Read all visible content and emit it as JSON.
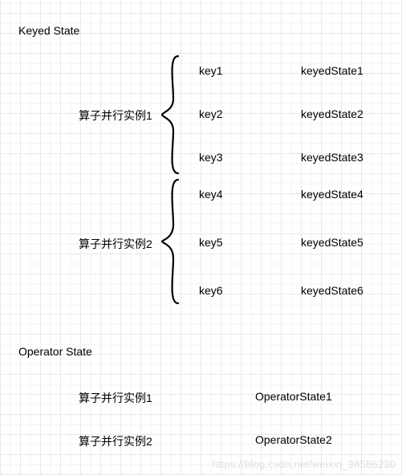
{
  "sections": {
    "keyed": {
      "title": "Keyed State",
      "groups": [
        {
          "label": "算子并行实例1",
          "items": [
            {
              "key": "key1",
              "state": "keyedState1"
            },
            {
              "key": "key2",
              "state": "keyedState2"
            },
            {
              "key": "key3",
              "state": "keyedState3"
            }
          ]
        },
        {
          "label": "算子并行实例2",
          "items": [
            {
              "key": "key4",
              "state": "keyedState4"
            },
            {
              "key": "key5",
              "state": "keyedState5"
            },
            {
              "key": "key6",
              "state": "keyedState6"
            }
          ]
        }
      ]
    },
    "operator": {
      "title": "Operator State",
      "rows": [
        {
          "label": "算子并行实例1",
          "state": "OperatorState1"
        },
        {
          "label": "算子并行实例2",
          "state": "OperatorState2"
        }
      ]
    }
  },
  "watermark": "https://blog.csdn.net/weixin_38586230"
}
